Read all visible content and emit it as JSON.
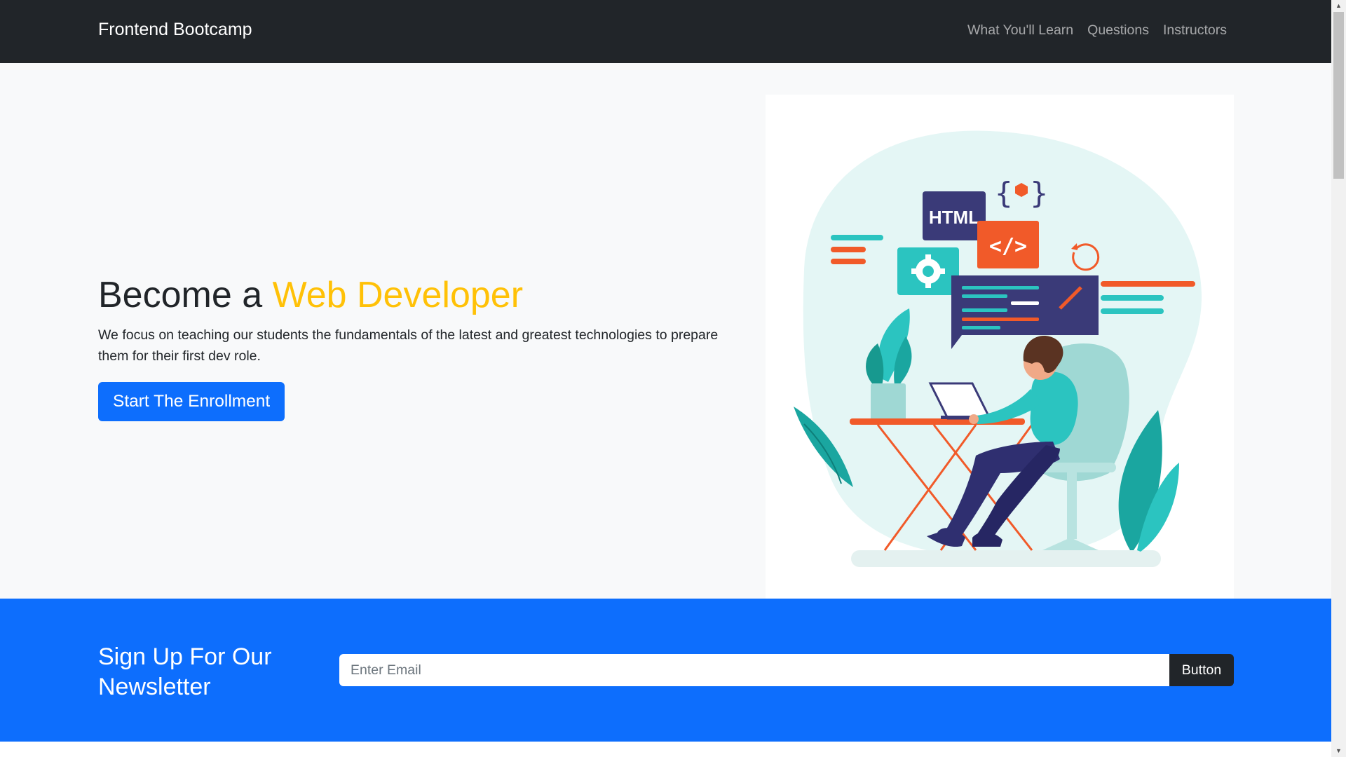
{
  "navbar": {
    "brand": "Frontend Bootcamp",
    "links": [
      "What You'll Learn",
      "Questions",
      "Instructors"
    ]
  },
  "showcase": {
    "title_prefix": "Become a ",
    "title_highlight": "Web Developer",
    "lead": "We focus on teaching our students the fundamentals of the latest and greatest technologies to prepare them for their first dev role.",
    "cta_label": "Start The Enrollment",
    "illustration": {
      "badge_text": "HTML",
      "code_symbol": "</>"
    }
  },
  "newsletter": {
    "title": "Sign Up For Our Newsletter",
    "email_placeholder": "Enter Email",
    "button_label": "Button"
  },
  "colors": {
    "navbar_bg": "#212529",
    "accent_yellow": "#ffc107",
    "primary_blue": "#0d6efd",
    "showcase_bg": "#f8f9fa"
  }
}
